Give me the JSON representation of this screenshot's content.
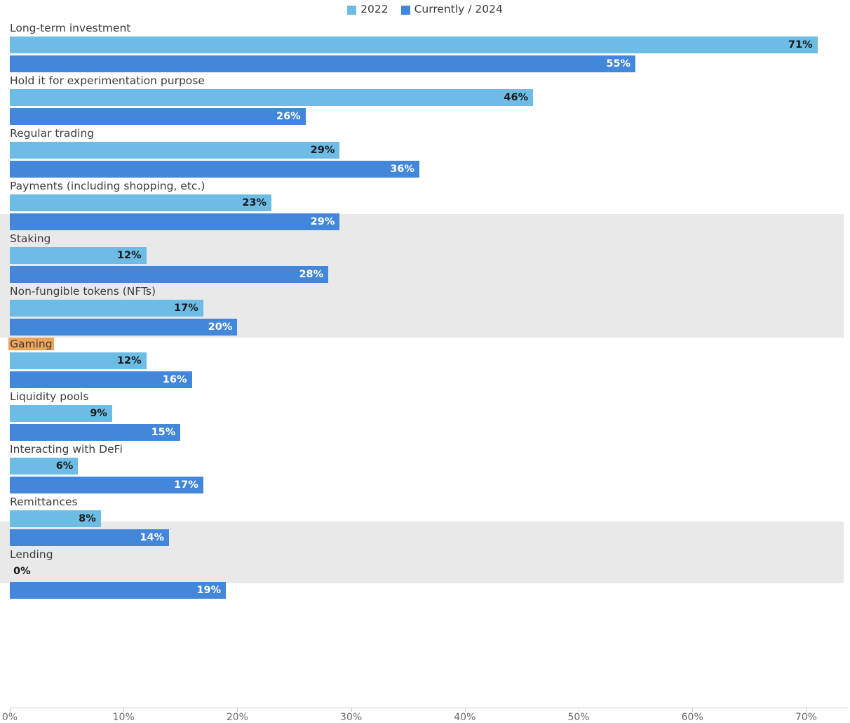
{
  "legend": {
    "items": [
      {
        "label": "2022",
        "color": "#6cbce5"
      },
      {
        "label": "Currently / 2024",
        "color": "#4287da"
      }
    ]
  },
  "colors": {
    "series_2022": "#6cbce5",
    "series_2024": "#4287da",
    "band": "#e9e9e9",
    "highlight": "#efa45c",
    "text": "#3c3c3c",
    "axis": "#d0d0d0"
  },
  "highlighted_category": "Gaming",
  "axis": {
    "ticks": [
      "0%",
      "10%",
      "20%",
      "30%",
      "40%",
      "50%",
      "60%",
      "70%"
    ],
    "values": [
      0,
      10,
      20,
      30,
      40,
      50,
      60,
      70
    ]
  },
  "chart_data": {
    "type": "bar",
    "orientation": "horizontal",
    "title": "",
    "xlabel": "",
    "ylabel": "",
    "xlim": [
      0,
      73
    ],
    "grid": false,
    "legend_position": "top-center",
    "categories": [
      "Long-term investment",
      "Hold it for experimentation purpose",
      "Regular trading",
      "Payments (including shopping, etc.)",
      "Staking",
      "Non-fungible tokens (NFTs)",
      "Gaming",
      "Liquidity pools",
      "Interacting with DeFi",
      "Remittances",
      "Lending"
    ],
    "series": [
      {
        "name": "2022",
        "color": "#6cbce5",
        "values": [
          71,
          46,
          29,
          23,
          12,
          17,
          12,
          9,
          6,
          8,
          0
        ],
        "labels": [
          "71%",
          "46%",
          "29%",
          "23%",
          "12%",
          "17%",
          "12%",
          "9%",
          "6%",
          "8%",
          "0%"
        ]
      },
      {
        "name": "Currently / 2024",
        "color": "#4287da",
        "values": [
          55,
          26,
          36,
          29,
          28,
          20,
          16,
          15,
          17,
          14,
          19
        ],
        "labels": [
          "55%",
          "26%",
          "36%",
          "29%",
          "28%",
          "20%",
          "16%",
          "15%",
          "17%",
          "14%",
          "19%"
        ]
      }
    ]
  }
}
